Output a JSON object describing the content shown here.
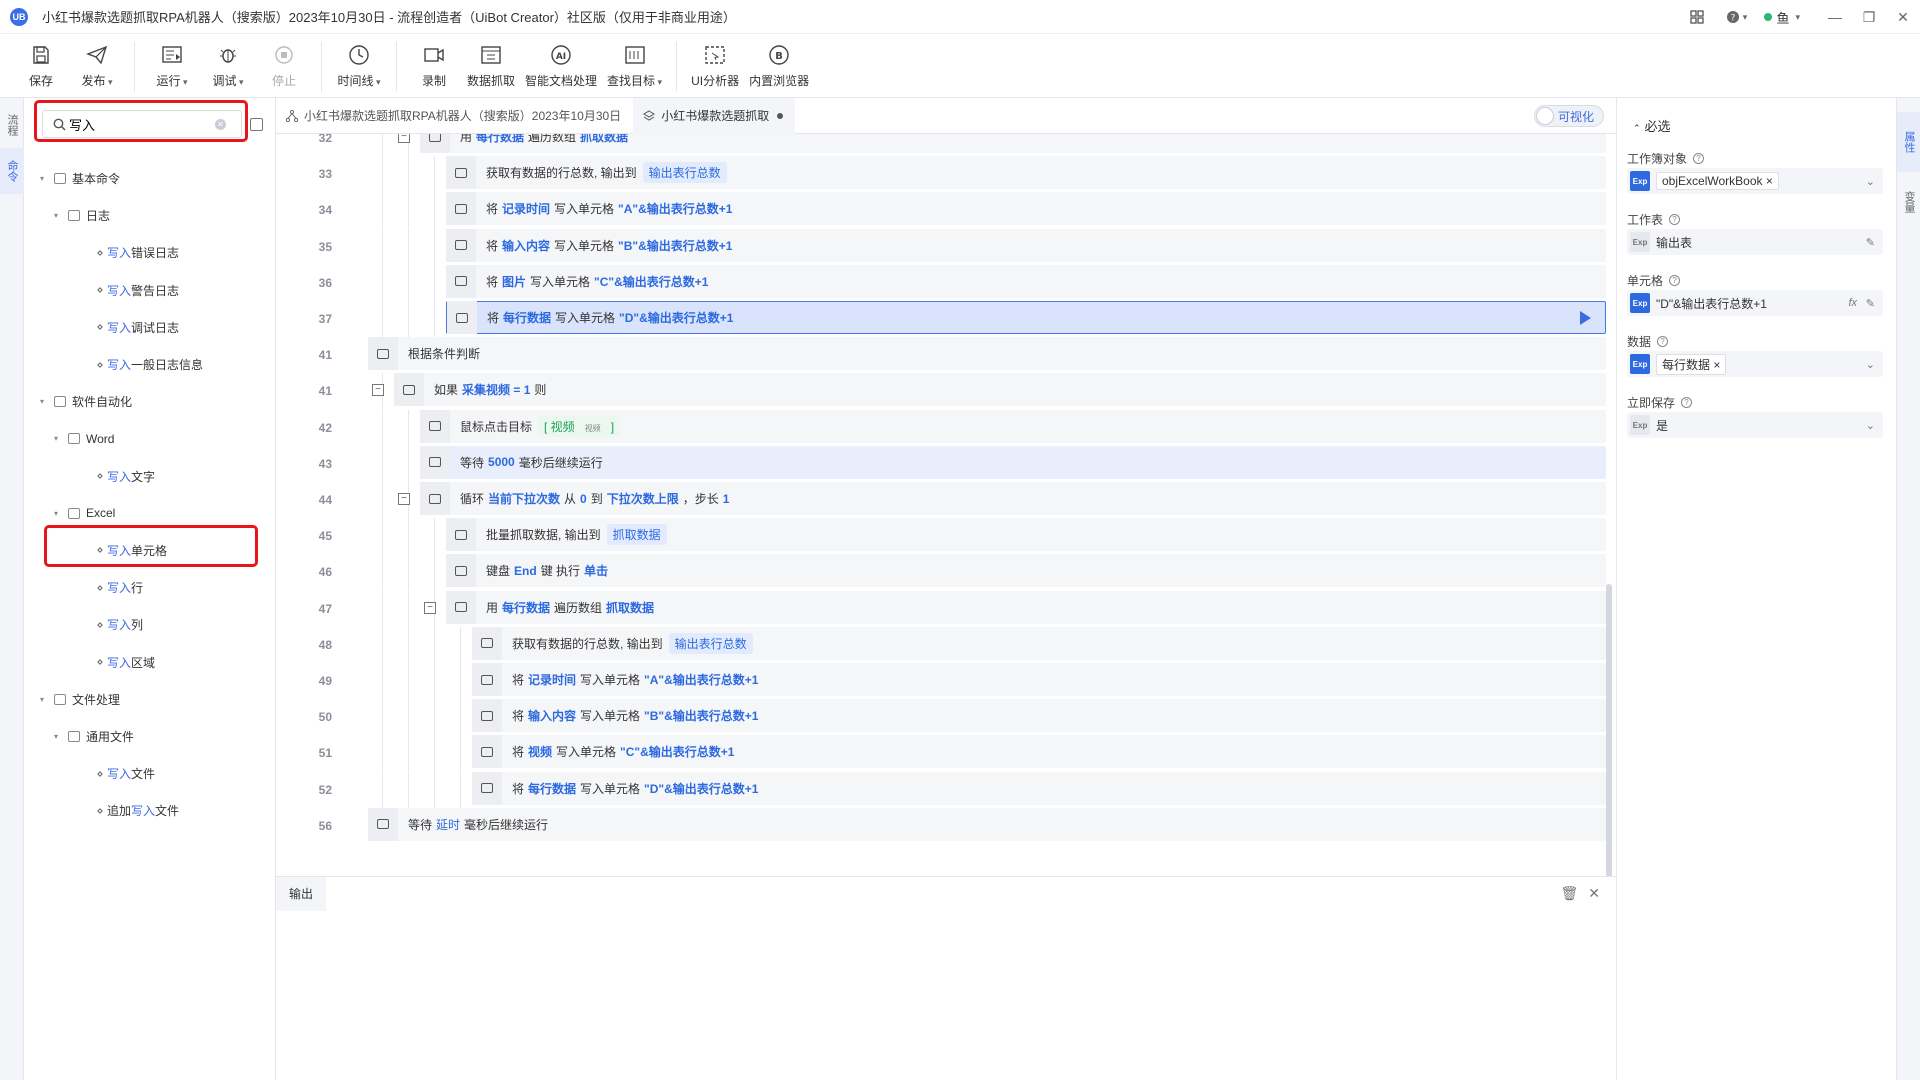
{
  "window": {
    "title": "小红书爆款选题抓取RPA机器人（搜索版）2023年10月30日 - 流程创造者（UiBot Creator）社区版（仅用于非商业用途）",
    "logo": "UB",
    "user": "鱼"
  },
  "toolbar": [
    {
      "label": "保存",
      "icon": "save-icon",
      "caret": false
    },
    {
      "label": "发布",
      "icon": "send-icon",
      "caret": true
    },
    {
      "sep": true
    },
    {
      "label": "运行",
      "icon": "run-icon",
      "caret": true
    },
    {
      "label": "调试",
      "icon": "debug-icon",
      "caret": true
    },
    {
      "label": "停止",
      "icon": "stop-icon",
      "caret": false,
      "disabled": true
    },
    {
      "sep": true
    },
    {
      "label": "时间线",
      "icon": "clock-icon",
      "caret": true
    },
    {
      "sep": true
    },
    {
      "label": "录制",
      "icon": "record-icon",
      "caret": false
    },
    {
      "label": "数据抓取",
      "icon": "scrape-icon",
      "caret": false
    },
    {
      "label": "智能文档处理",
      "icon": "ai-doc-icon",
      "caret": false
    },
    {
      "label": "查找目标",
      "icon": "target-icon",
      "caret": true
    },
    {
      "sep": true
    },
    {
      "label": "UI分析器",
      "icon": "ui-analyzer-icon",
      "caret": false
    },
    {
      "label": "内置浏览器",
      "icon": "browser-icon",
      "caret": false
    }
  ],
  "left_rail": [
    "流程",
    "命令"
  ],
  "search": {
    "value": "写入",
    "placeholder": ""
  },
  "tree": [
    {
      "level": 0,
      "label": "基本命令",
      "arrow": "▾",
      "icon": true
    },
    {
      "level": 1,
      "label": "日志",
      "arrow": "▾",
      "icon": true
    },
    {
      "level": 2,
      "hl": "写入",
      "label": "错误日志"
    },
    {
      "level": 2,
      "hl": "写入",
      "label": "警告日志"
    },
    {
      "level": 2,
      "hl": "写入",
      "label": "调试日志"
    },
    {
      "level": 2,
      "hl": "写入",
      "label": "一般日志信息"
    },
    {
      "level": 0,
      "label": "软件自动化",
      "arrow": "▾",
      "icon": true
    },
    {
      "level": 1,
      "label": "Word",
      "arrow": "▾",
      "icon": true
    },
    {
      "level": 2,
      "hl": "写入",
      "label": "文字"
    },
    {
      "level": 1,
      "label": "Excel",
      "arrow": "▾",
      "icon": true
    },
    {
      "level": 2,
      "hl": "写入",
      "label": "单元格",
      "boxed": true
    },
    {
      "level": 2,
      "hl": "写入",
      "label": "行"
    },
    {
      "level": 2,
      "hl": "写入",
      "label": "列"
    },
    {
      "level": 2,
      "hl": "写入",
      "label": "区域"
    },
    {
      "level": 0,
      "label": "文件处理",
      "arrow": "▾",
      "icon": true
    },
    {
      "level": 1,
      "label": "通用文件",
      "arrow": "▾",
      "icon": true
    },
    {
      "level": 2,
      "hl": "写入",
      "label": "文件"
    },
    {
      "level": 2,
      "pre": "追加",
      "hl": "写入",
      "label": "文件"
    }
  ],
  "tabs": [
    {
      "label": "小红书爆款选题抓取RPA机器人（搜索版）2023年10月30日",
      "icon": "flow-icon",
      "active": false
    },
    {
      "label": "小红书爆款选题抓取",
      "icon": "layers-icon",
      "active": true,
      "modified": true
    }
  ],
  "visualize_label": "可视化",
  "code_rows": [
    {
      "ln": "32",
      "depth": 6,
      "fold": true,
      "parts": [
        [
          "t",
          "用"
        ],
        [
          "k",
          "每行数据"
        ],
        [
          "t",
          "遍历数组"
        ],
        [
          "k",
          "抓取数据"
        ]
      ]
    },
    {
      "ln": "33",
      "depth": 7,
      "parts": [
        [
          "t",
          "获取有数据的行总数, 输出到"
        ],
        [
          "tag",
          "输出表行总数"
        ]
      ]
    },
    {
      "ln": "34",
      "depth": 7,
      "parts": [
        [
          "t",
          "将"
        ],
        [
          "k",
          "记录时间"
        ],
        [
          "t",
          "写入单元格"
        ],
        [
          "k",
          "\"A\"&输出表行总数+1"
        ]
      ]
    },
    {
      "ln": "35",
      "depth": 7,
      "parts": [
        [
          "t",
          "将"
        ],
        [
          "k",
          "输入内容"
        ],
        [
          "t",
          "写入单元格"
        ],
        [
          "k",
          "\"B\"&输出表行总数+1"
        ]
      ]
    },
    {
      "ln": "36",
      "depth": 7,
      "parts": [
        [
          "t",
          "将"
        ],
        [
          "k",
          "图片"
        ],
        [
          "t",
          "写入单元格"
        ],
        [
          "k",
          "\"C\"&输出表行总数+1"
        ]
      ]
    },
    {
      "ln": "37",
      "depth": 7,
      "sel": true,
      "play": true,
      "parts": [
        [
          "t",
          "将"
        ],
        [
          "k",
          "每行数据"
        ],
        [
          "t",
          "写入单元格"
        ],
        [
          "k",
          "\"D\"&输出表行总数+1"
        ]
      ]
    },
    {
      "ln": "41",
      "depth": 4,
      "parts": [
        [
          "t",
          "根据条件判断"
        ]
      ]
    },
    {
      "ln": "41",
      "depth": 5,
      "fold": true,
      "parts": [
        [
          "t",
          "如果"
        ],
        [
          "k",
          "采集视频 = 1"
        ],
        [
          "t",
          "则"
        ]
      ]
    },
    {
      "ln": "42",
      "depth": 6,
      "parts": [
        [
          "t",
          "鼠标点击目标"
        ],
        [
          "gtag",
          "[ 视频",
          "视频",
          "]"
        ]
      ]
    },
    {
      "ln": "43",
      "depth": 6,
      "soft": true,
      "parts": [
        [
          "t",
          "等待"
        ],
        [
          "k",
          "5000"
        ],
        [
          "t",
          "毫秒后继续运行"
        ]
      ]
    },
    {
      "ln": "44",
      "depth": 6,
      "fold": true,
      "parts": [
        [
          "t",
          "循环"
        ],
        [
          "k",
          "当前下拉次数"
        ],
        [
          "t",
          "从"
        ],
        [
          "k",
          "0"
        ],
        [
          "t",
          "到"
        ],
        [
          "k",
          "下拉次数上限"
        ],
        [
          "t",
          "，步长"
        ],
        [
          "k",
          "1"
        ]
      ]
    },
    {
      "ln": "45",
      "depth": 7,
      "parts": [
        [
          "t",
          "批量抓取数据, 输出到"
        ],
        [
          "tag",
          "抓取数据"
        ]
      ]
    },
    {
      "ln": "46",
      "depth": 7,
      "parts": [
        [
          "t",
          "键盘"
        ],
        [
          "k",
          "End"
        ],
        [
          "t",
          "键 执行"
        ],
        [
          "k",
          "单击"
        ]
      ]
    },
    {
      "ln": "47",
      "depth": 7,
      "fold": true,
      "parts": [
        [
          "t",
          "用"
        ],
        [
          "k",
          "每行数据"
        ],
        [
          "t",
          "遍历数组"
        ],
        [
          "k",
          "抓取数据"
        ]
      ]
    },
    {
      "ln": "48",
      "depth": 8,
      "parts": [
        [
          "t",
          "获取有数据的行总数, 输出到"
        ],
        [
          "tag",
          "输出表行总数"
        ]
      ]
    },
    {
      "ln": "49",
      "depth": 8,
      "parts": [
        [
          "t",
          "将"
        ],
        [
          "k",
          "记录时间"
        ],
        [
          "t",
          "写入单元格"
        ],
        [
          "k",
          "\"A\"&输出表行总数+1"
        ]
      ]
    },
    {
      "ln": "50",
      "depth": 8,
      "parts": [
        [
          "t",
          "将"
        ],
        [
          "k",
          "输入内容"
        ],
        [
          "t",
          "写入单元格"
        ],
        [
          "k",
          "\"B\"&输出表行总数+1"
        ]
      ]
    },
    {
      "ln": "51",
      "depth": 8,
      "parts": [
        [
          "t",
          "将"
        ],
        [
          "k",
          "视频"
        ],
        [
          "t",
          "写入单元格"
        ],
        [
          "k",
          "\"C\"&输出表行总数+1"
        ]
      ]
    },
    {
      "ln": "52",
      "depth": 8,
      "parts": [
        [
          "t",
          "将"
        ],
        [
          "k",
          "每行数据"
        ],
        [
          "t",
          "写入单元格"
        ],
        [
          "k",
          "\"D\"&输出表行总数+1"
        ]
      ]
    },
    {
      "ln": "56",
      "depth": 4,
      "parts": [
        [
          "t",
          "等待"
        ],
        [
          "k2",
          "延时"
        ],
        [
          "t",
          "毫秒后继续运行"
        ]
      ]
    }
  ],
  "output": {
    "tab_label": "输出"
  },
  "props": {
    "section": "必选",
    "fields": [
      {
        "label": "工作簿对象",
        "exp": "Exp",
        "chip": "objExcelWorkBook ×",
        "dropdown": true
      },
      {
        "label": "工作表",
        "exp": "Exp",
        "light": true,
        "value": "输出表",
        "edit": true
      },
      {
        "label": "单元格",
        "exp": "Exp",
        "value": "\"D\"&输出表行总数+1",
        "fx": "fx",
        "edit": true
      },
      {
        "label": "数据",
        "exp": "Exp",
        "chip": "每行数据 ×",
        "dropdown": true
      },
      {
        "label": "立即保存",
        "exp": "Exp",
        "light": true,
        "value": "是",
        "dropdown": true
      }
    ]
  },
  "right_rail": [
    "属性",
    "变量"
  ],
  "colors": {
    "accent": "#3d6be0",
    "highlight_box": "#e8151b",
    "selection": "#d9e3fb"
  }
}
